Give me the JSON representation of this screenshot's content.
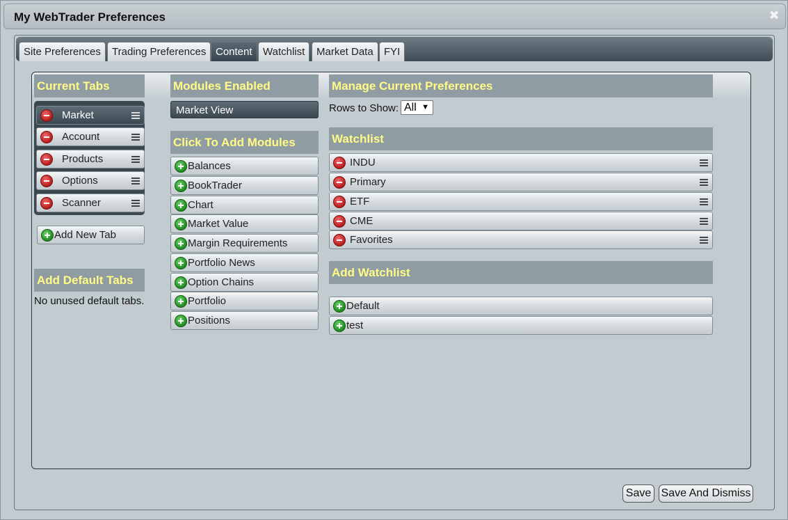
{
  "window": {
    "title": "My WebTrader Preferences",
    "close_label": "✖"
  },
  "tabs": [
    {
      "label": "Site Preferences"
    },
    {
      "label": "Trading Preferences"
    },
    {
      "label": "Content",
      "active": true
    },
    {
      "label": "Watchlist"
    },
    {
      "label": "Market Data"
    },
    {
      "label": "FYI"
    }
  ],
  "current_tabs": {
    "header": "Current Tabs",
    "items": [
      {
        "label": "Market",
        "selected": true
      },
      {
        "label": "Account"
      },
      {
        "label": "Products"
      },
      {
        "label": "Options"
      },
      {
        "label": "Scanner"
      }
    ],
    "add_new_tab_label": "Add New Tab"
  },
  "default_tabs": {
    "header": "Add Default Tabs",
    "message": "No unused default tabs."
  },
  "modules": {
    "enabled_header": "Modules Enabled",
    "enabled": [
      {
        "label": "Market View"
      }
    ],
    "add_header": "Click To Add Modules",
    "available": [
      {
        "label": "Balances"
      },
      {
        "label": "BookTrader"
      },
      {
        "label": "Chart"
      },
      {
        "label": "Market Value"
      },
      {
        "label": "Margin Requirements"
      },
      {
        "label": "Portfolio News"
      },
      {
        "label": "Option Chains"
      },
      {
        "label": "Portfolio"
      },
      {
        "label": "Positions"
      }
    ]
  },
  "manage": {
    "header": "Manage Current Preferences",
    "rows_label": "Rows to Show:",
    "rows_value": "All"
  },
  "watchlist": {
    "header": "Watchlist",
    "items": [
      {
        "label": "INDU"
      },
      {
        "label": "Primary"
      },
      {
        "label": "ETF"
      },
      {
        "label": "CME"
      },
      {
        "label": "Favorites"
      }
    ]
  },
  "add_watchlist": {
    "header": "Add Watchlist",
    "items": [
      {
        "label": "Default"
      },
      {
        "label": "test"
      }
    ]
  },
  "footer": {
    "save_label": "Save",
    "save_dismiss_label": "Save And Dismiss"
  },
  "colors": {
    "header_text": "#fffb84",
    "header_bg": "#8f9ca4",
    "dialog_bg": "#c2cbd0",
    "remove_icon": "#c62828",
    "add_icon": "#2e9b2e"
  }
}
